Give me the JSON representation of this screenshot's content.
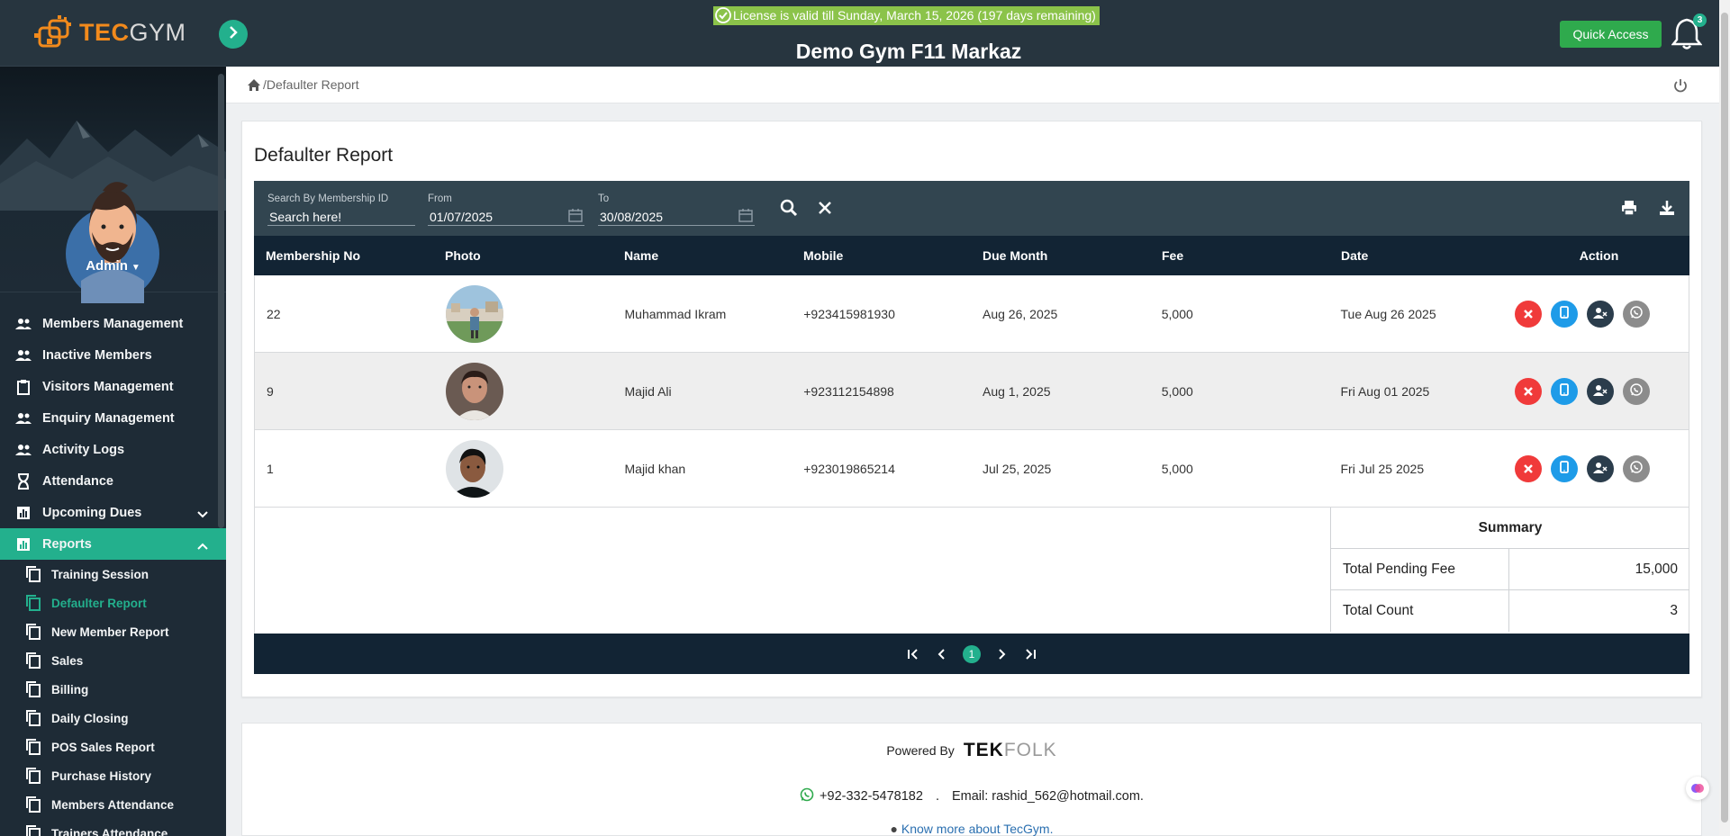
{
  "brand": {
    "logo_tec": "TEC",
    "logo_gym": "GYM"
  },
  "topbar": {
    "license": "License is valid till Sunday, March 15, 2026 (197 days remaining)",
    "gym_name": "Demo Gym F11 Markaz",
    "quick_access": "Quick Access",
    "notification_count": "3"
  },
  "sidebar": {
    "user": "Admin",
    "menu": [
      {
        "label": "Members Management",
        "icon": "people-icon"
      },
      {
        "label": "Inactive Members",
        "icon": "people-icon"
      },
      {
        "label": "Visitors Management",
        "icon": "clipboard-icon"
      },
      {
        "label": "Enquiry Management",
        "icon": "people-icon"
      },
      {
        "label": "Activity Logs",
        "icon": "people-icon"
      },
      {
        "label": "Attendance",
        "icon": "hourglass-icon"
      },
      {
        "label": "Upcoming Dues",
        "icon": "chart-icon"
      },
      {
        "label": "Reports",
        "icon": "chart-icon"
      }
    ],
    "reports_sub": [
      "Training Session",
      "Defaulter Report",
      "New Member Report",
      "Sales",
      "Billing",
      "Daily Closing",
      "POS Sales Report",
      "Purchase History",
      "Members Attendance",
      "Trainers Attendance"
    ]
  },
  "breadcrumb": {
    "separator": "/",
    "current": "Defaulter Report"
  },
  "page": {
    "title": "Defaulter Report",
    "filters": {
      "membership_label": "Search By Membership ID",
      "membership_placeholder": "Search here!",
      "from_label": "From",
      "from_value": "01/07/2025",
      "to_label": "To",
      "to_value": "30/08/2025"
    },
    "columns": [
      "Membership No",
      "Photo",
      "Name",
      "Mobile",
      "Due Month",
      "Fee",
      "Date",
      "Action"
    ],
    "rows": [
      {
        "membership_no": "22",
        "name": "Muhammad Ikram",
        "mobile": "+923415981930",
        "due_month": "Aug 26, 2025",
        "fee": "5,000",
        "date": "Tue Aug 26 2025"
      },
      {
        "membership_no": "9",
        "name": "Majid Ali",
        "mobile": "+923112154898",
        "due_month": "Aug 1, 2025",
        "fee": "5,000",
        "date": "Fri Aug 01 2025"
      },
      {
        "membership_no": "1",
        "name": "Majid khan",
        "mobile": "+923019865214",
        "due_month": "Jul 25, 2025",
        "fee": "5,000",
        "date": "Fri Jul 25 2025"
      }
    ],
    "summary": {
      "title": "Summary",
      "pending_label": "Total Pending Fee",
      "pending_value": "15,000",
      "count_label": "Total Count",
      "count_value": "3"
    },
    "pagination": {
      "current_page": "1"
    }
  },
  "footer": {
    "powered_by": "Powered By",
    "brand_tk": "TEK",
    "brand_folk": "FOLK",
    "phone": "+92-332-5478182",
    "sep": ".",
    "email": "Email: rashid_562@hotmail.com.",
    "know_more": "Know more about TecGym."
  },
  "colors": {
    "accent": "#23b08d",
    "sidebar": "#1e2b36",
    "header": "#27353f",
    "table_head": "#122434",
    "license": "#8bc34a",
    "quick_access": "#2faa4d"
  }
}
